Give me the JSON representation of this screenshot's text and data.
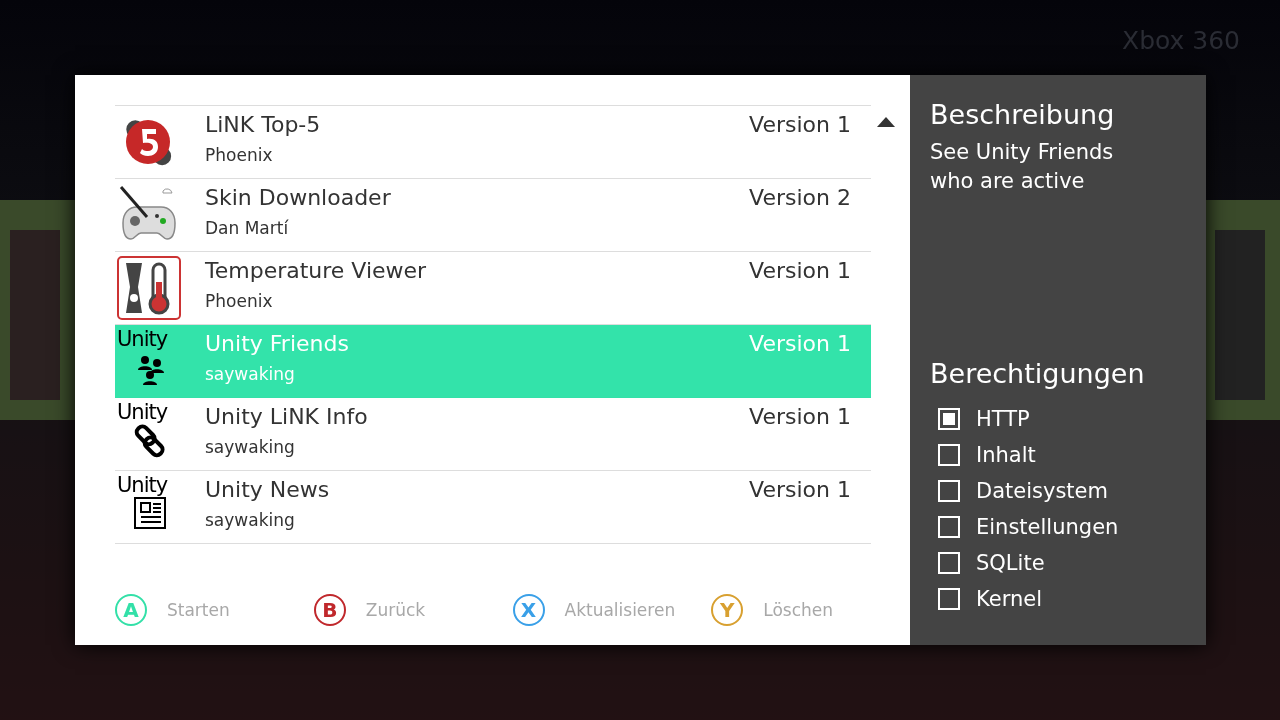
{
  "header": {
    "title": "Xbox 360"
  },
  "apps": [
    {
      "name": "LiNK Top-5",
      "author": "Phoenix",
      "version": "Version 1",
      "kind": "top5",
      "selected": false
    },
    {
      "name": "Skin Downloader",
      "author": "Dan Martí",
      "version": "Version 2",
      "kind": "controller",
      "selected": false
    },
    {
      "name": "Temperature Viewer",
      "author": "Phoenix",
      "version": "Version 1",
      "kind": "thermo",
      "selected": false
    },
    {
      "name": "Unity Friends",
      "author": "saywaking",
      "version": "Version 1",
      "kind": "friends",
      "logo_text": "Unity",
      "selected": true
    },
    {
      "name": "Unity LiNK Info",
      "author": "saywaking",
      "version": "Version 1",
      "kind": "link",
      "logo_text": "Unity",
      "selected": false
    },
    {
      "name": "Unity News",
      "author": "saywaking",
      "version": "Version 1",
      "kind": "news",
      "logo_text": "Unity",
      "selected": false
    }
  ],
  "actions": [
    {
      "key": "A",
      "label": "Starten",
      "color": "#33e0a8"
    },
    {
      "key": "B",
      "label": "Zurück",
      "color": "#c0282c"
    },
    {
      "key": "X",
      "label": "Aktualisieren",
      "color": "#3aa0e8"
    },
    {
      "key": "Y",
      "label": "Löschen",
      "color": "#d8a030"
    }
  ],
  "description": {
    "heading": "Beschreibung",
    "text": "See Unity Friends who are active"
  },
  "permissions": {
    "heading": "Berechtigungen",
    "items": [
      {
        "label": "HTTP",
        "checked": true
      },
      {
        "label": "Inhalt",
        "checked": false
      },
      {
        "label": "Dateisystem",
        "checked": false
      },
      {
        "label": "Einstellungen",
        "checked": false
      },
      {
        "label": "SQLite",
        "checked": false
      },
      {
        "label": "Kernel",
        "checked": false
      }
    ]
  }
}
